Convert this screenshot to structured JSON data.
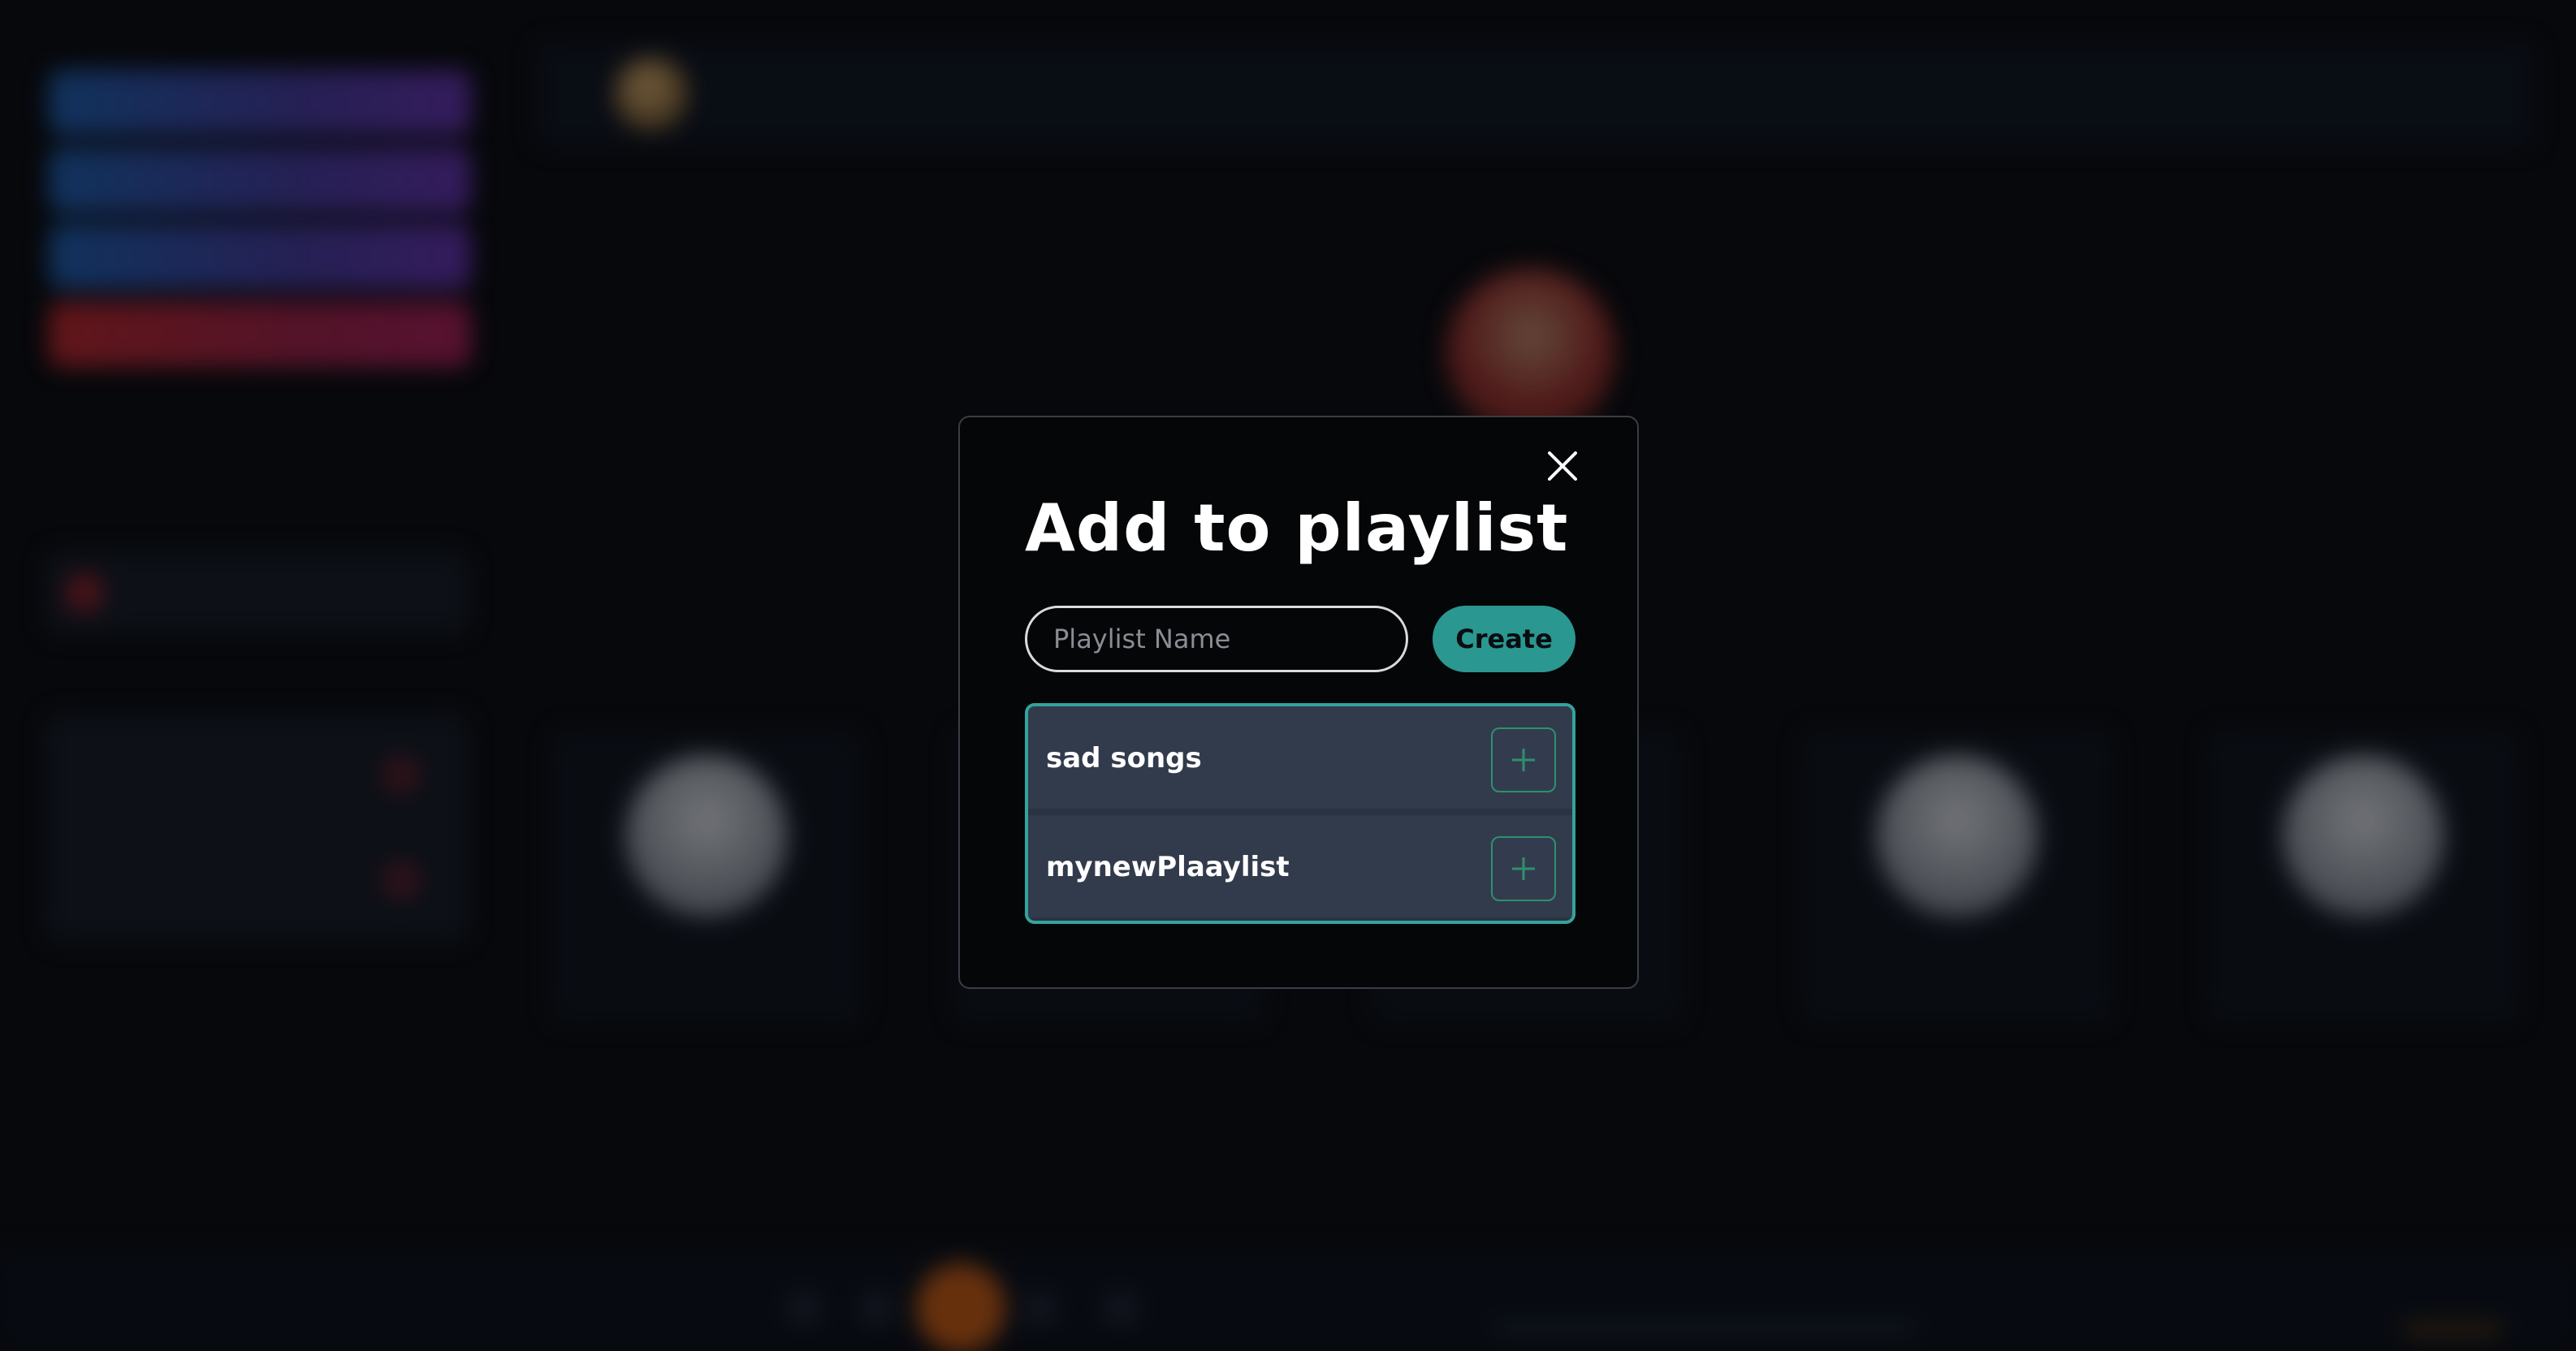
{
  "modal": {
    "title": "Add to playlist",
    "input_placeholder": "Playlist Name",
    "input_value": "",
    "create_label": "Create",
    "playlists": [
      {
        "name": "sad songs"
      },
      {
        "name": "mynewPlaaylist"
      }
    ]
  },
  "icons": {
    "close": "close-icon",
    "add": "plus-icon"
  },
  "colors": {
    "accent": "#2a9790",
    "list_border": "#34a39b",
    "add_icon": "#2f8f6e",
    "modal_bg": "#050608"
  }
}
